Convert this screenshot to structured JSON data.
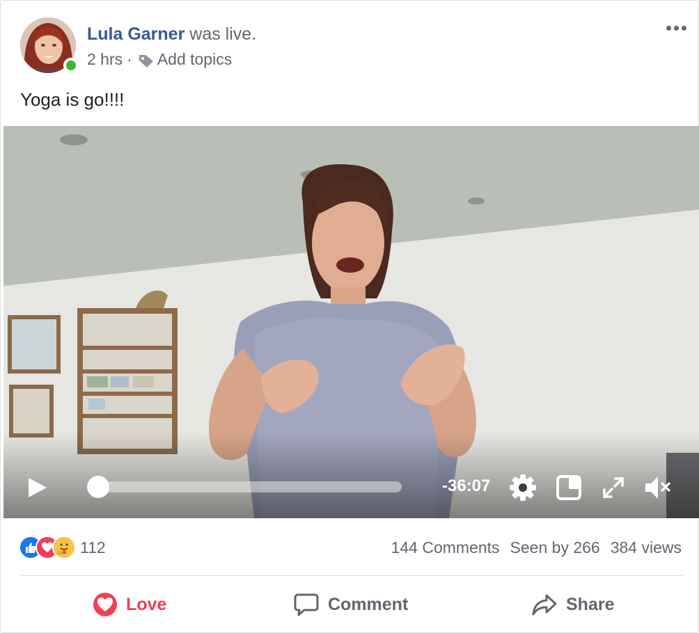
{
  "header": {
    "author": "Lula Garner",
    "status_text": "was live.",
    "time": "2 hrs",
    "separator": "·",
    "topics_label": "Add topics"
  },
  "post": {
    "text": "Yoga is go!!!!"
  },
  "video": {
    "time_remaining": "-36:07",
    "progress": 0.0,
    "icons": [
      "play-icon",
      "settings-gear-icon",
      "picture-in-picture-icon",
      "fullscreen-expand-icon",
      "muted-speaker-icon"
    ]
  },
  "stats": {
    "reactions": [
      "like",
      "love",
      "care"
    ],
    "reaction_count": "112",
    "comments": "144 Comments",
    "seen_by": "Seen by 266",
    "views": "384 views"
  },
  "actions": {
    "love_label": "Love",
    "comment_label": "Comment",
    "share_label": "Share"
  },
  "colors": {
    "author_link": "#385898",
    "love_red": "#f33e58",
    "online_green": "#42b72a",
    "secondary_text": "#606770"
  }
}
